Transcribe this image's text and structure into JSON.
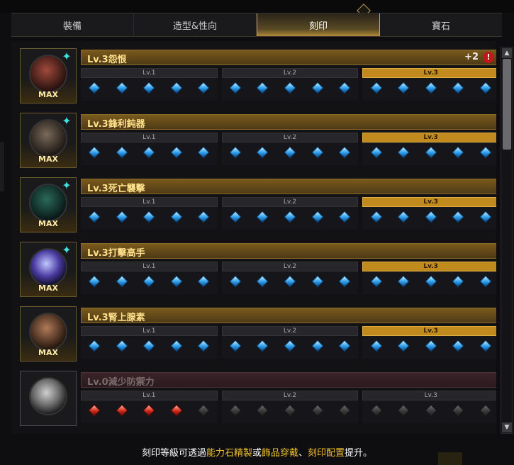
{
  "tabs": [
    {
      "label": "裝備",
      "active": false
    },
    {
      "label": "造型&性向",
      "active": false
    },
    {
      "label": "刻印",
      "active": true
    },
    {
      "label": "寶石",
      "active": false
    }
  ],
  "level_labels": [
    "Lv.1",
    "Lv.2",
    "Lv.3"
  ],
  "engravings": [
    {
      "title": "Lv.3怨恨",
      "max_label": "MAX",
      "has_badge": true,
      "plus": "+2",
      "warn": "!",
      "active_level": 3,
      "icon": "grudge-engraving-icon"
    },
    {
      "title": "Lv.3鋒利鈍器",
      "max_label": "MAX",
      "has_badge": true,
      "plus": "",
      "warn": "",
      "active_level": 3,
      "icon": "keen-blunt-weapon-engraving-icon"
    },
    {
      "title": "Lv.3死亡襲擊",
      "max_label": "MAX",
      "has_badge": true,
      "plus": "",
      "warn": "",
      "active_level": 3,
      "icon": "ambush-master-engraving-icon"
    },
    {
      "title": "Lv.3打擊高手",
      "max_label": "MAX",
      "has_badge": true,
      "plus": "",
      "warn": "",
      "active_level": 3,
      "icon": "hit-master-engraving-icon"
    },
    {
      "title": "Lv.3腎上腺素",
      "max_label": "MAX",
      "has_badge": false,
      "plus": "",
      "warn": "",
      "active_level": 3,
      "icon": "adrenaline-engraving-icon"
    },
    {
      "title": "Lv.0減少防禦力",
      "max_label": "",
      "has_badge": false,
      "plus": "",
      "warn": "",
      "active_level": 0,
      "icon": "defense-reduction-engraving-icon"
    }
  ],
  "footer": {
    "prefix": "刻印等級可透過",
    "link1": "能力石精製",
    "mid1": "或",
    "link2": "飾品穿戴",
    "mid2": "、",
    "link3": "刻印配置",
    "suffix": "提升。"
  },
  "colors": {
    "accent": "#f0c030",
    "gem_active": "#2a9ae8",
    "gem_negative": "#d02a1a"
  }
}
